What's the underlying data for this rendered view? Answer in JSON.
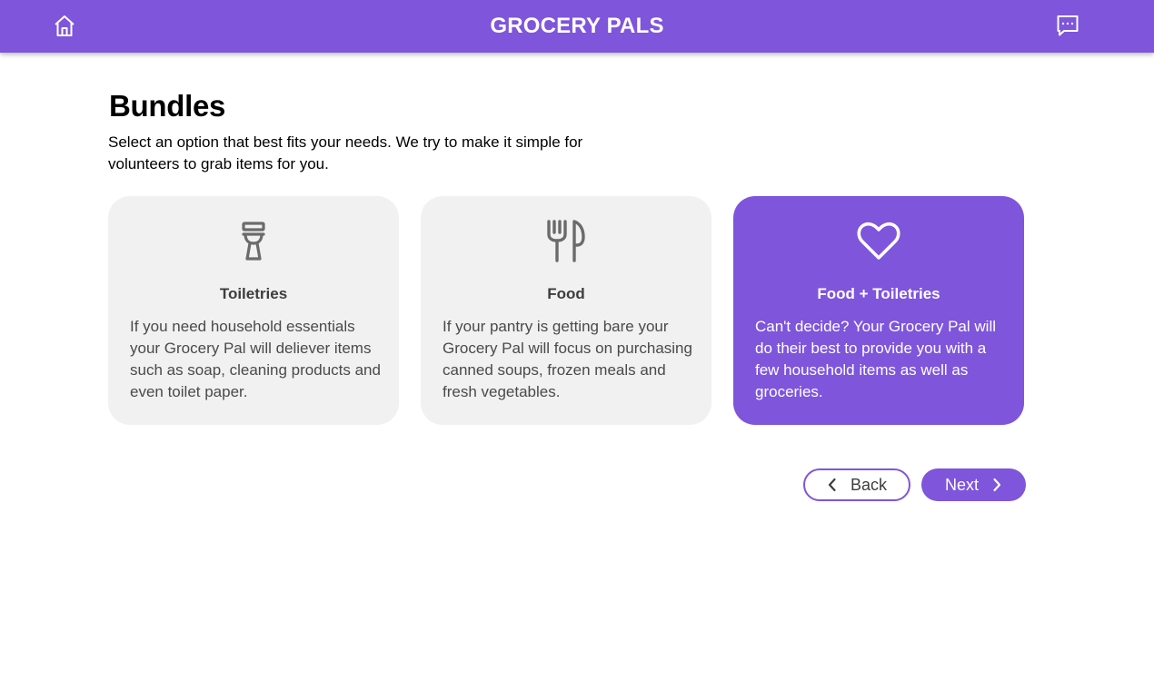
{
  "header": {
    "title": "GROCERY PALS",
    "home_icon": "home-icon",
    "chat_icon": "chat-icon"
  },
  "page": {
    "title": "Bundles",
    "description": "Select an option that best fits your needs. We try to make it simple for volunteers to grab items for you."
  },
  "bundles": [
    {
      "icon": "toilet-icon",
      "title": "Toiletries",
      "description": "If you need household essentials your Grocery Pal will deliever items such as soap, cleaning products and even toilet paper.",
      "selected": false
    },
    {
      "icon": "utensils-icon",
      "title": "Food",
      "description": "If your pantry is getting bare your Grocery Pal will focus on purchasing canned soups, frozen meals and fresh vegetables.",
      "selected": false
    },
    {
      "icon": "heart-icon",
      "title": "Food + Toiletries",
      "description": "Can't decide? Your Grocery Pal will do their best to provide you with a few household items as well as groceries.",
      "selected": true
    }
  ],
  "nav": {
    "back_label": "Back",
    "next_label": "Next"
  },
  "colors": {
    "accent": "#7E55DB",
    "card_bg": "#F1F1F1"
  }
}
